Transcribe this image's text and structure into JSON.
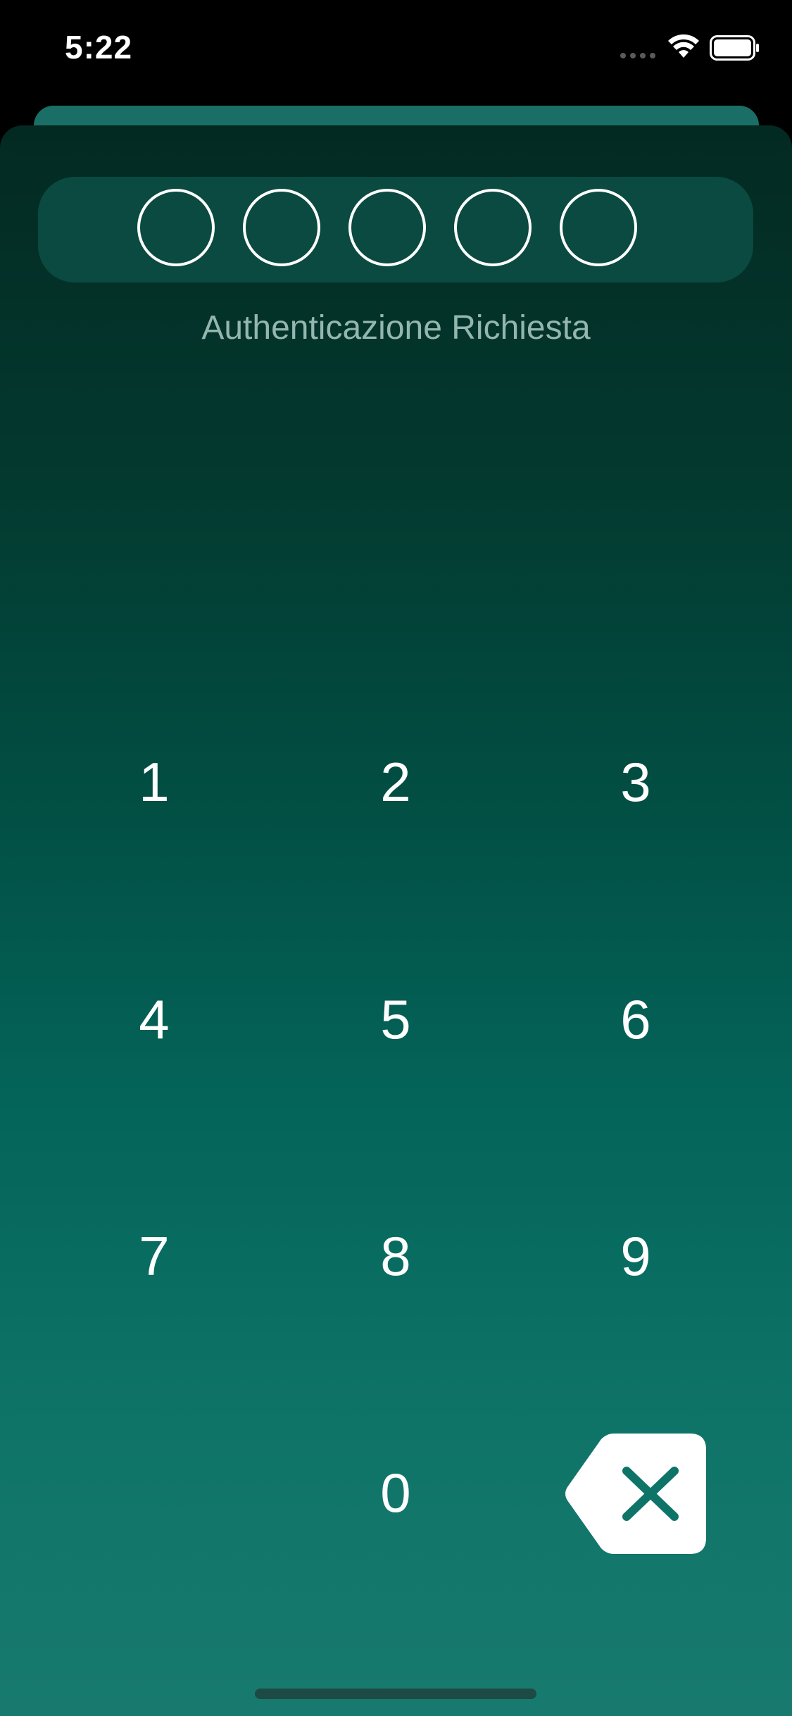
{
  "status_bar": {
    "time": "5:22",
    "icons": [
      "cellular-signal-icon",
      "wifi-icon",
      "battery-icon"
    ]
  },
  "pin_entry": {
    "digits_entered": 0,
    "digits_total": 5
  },
  "auth": {
    "label": "Authenticazione Richiesta"
  },
  "keypad": {
    "keys": [
      "1",
      "2",
      "3",
      "4",
      "5",
      "6",
      "7",
      "8",
      "9",
      "0"
    ],
    "delete_icon": "delete-backspace-icon"
  },
  "colors": {
    "gradient_top": "#032a22",
    "gradient_bottom": "#187a6e",
    "pin_box": "#0a4a40",
    "label": "#93b6ae",
    "delete_button_bg": "#ffffff",
    "delete_glyph": "#0f7468"
  }
}
